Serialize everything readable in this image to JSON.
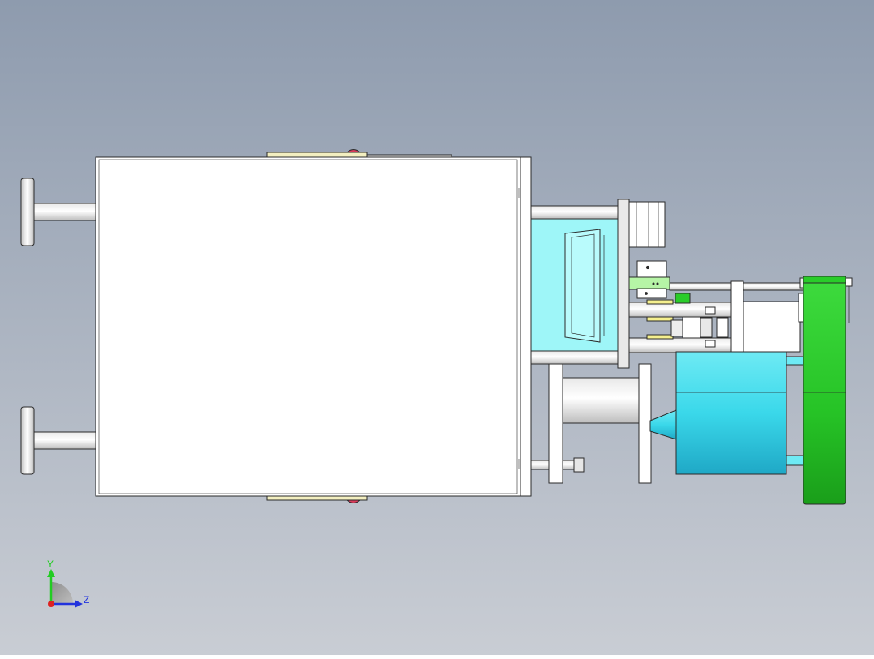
{
  "viewport": {
    "background_top": "#8E9BAE",
    "background_bottom": "#C9CDD4"
  },
  "triad": {
    "y_label": "Y",
    "z_label": "Z",
    "y_color": "#22CC22",
    "z_color": "#2233DD",
    "x_color": "#DD2222"
  },
  "colors": {
    "outline": "#2A2A2A",
    "white_part": "#FFFFFF",
    "grey_part": "#DCDCDC",
    "cyan_light": "#9EF6F8",
    "cyan": "#35D6E8",
    "green": "#29CC29",
    "light_green": "#B6F5A6",
    "yellow": "#F5F08E"
  }
}
